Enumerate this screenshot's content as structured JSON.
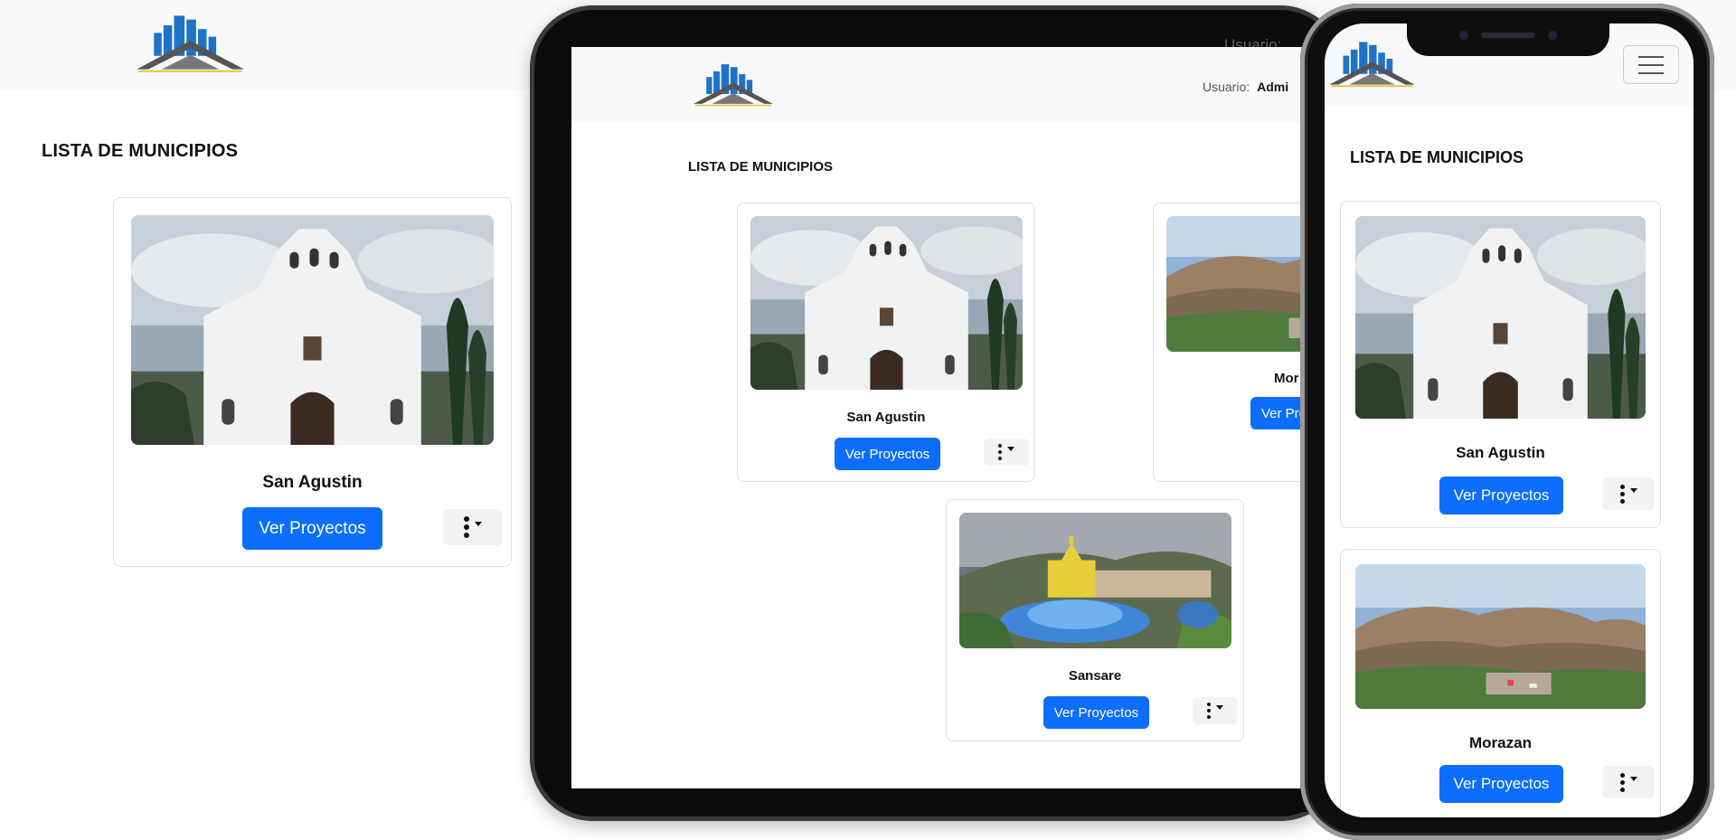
{
  "app": {
    "page_title": "LISTA DE MUNICIPIOS",
    "user_label": "Usuario:",
    "user_name": "Admin",
    "button_label": "Ver Proyectos"
  },
  "desktop": {
    "title": "LISTA DE MUNICIPIOS",
    "cards": [
      {
        "name": "San Agustin",
        "button": "Ver Proyectos",
        "image": "church-photo"
      }
    ]
  },
  "tablet": {
    "ghost_user_label": "Usuario:",
    "user_label": "Usuario:",
    "user_name": "Admi",
    "title": "LISTA DE MUNICIPIOS",
    "cards": [
      {
        "name": "San Agustin",
        "button": "Ver Proyectos",
        "image": "church-photo"
      },
      {
        "name": "Mor",
        "button": "Ver Pro",
        "image": "valley-photo"
      },
      {
        "name": "Sansare",
        "button": "Ver Proyectos",
        "image": "plaza-photo"
      }
    ]
  },
  "phone": {
    "title": "LISTA DE MUNICIPIOS",
    "cards": [
      {
        "name": "San Agustin",
        "button": "Ver Proyectos",
        "image": "church-photo"
      },
      {
        "name": "Morazan",
        "button": "Ver Proyectos",
        "image": "valley-photo"
      }
    ]
  },
  "icons": {
    "logo": "building-house-logo",
    "menu": "hamburger-menu-icon",
    "kebab": "kebab-dropdown-icon"
  },
  "colors": {
    "primary": "#0d6efd",
    "header_bg": "#f8f9fa",
    "card_border": "#dee2e6",
    "logo_blue": "#1e73c8",
    "logo_gray": "#555555"
  }
}
